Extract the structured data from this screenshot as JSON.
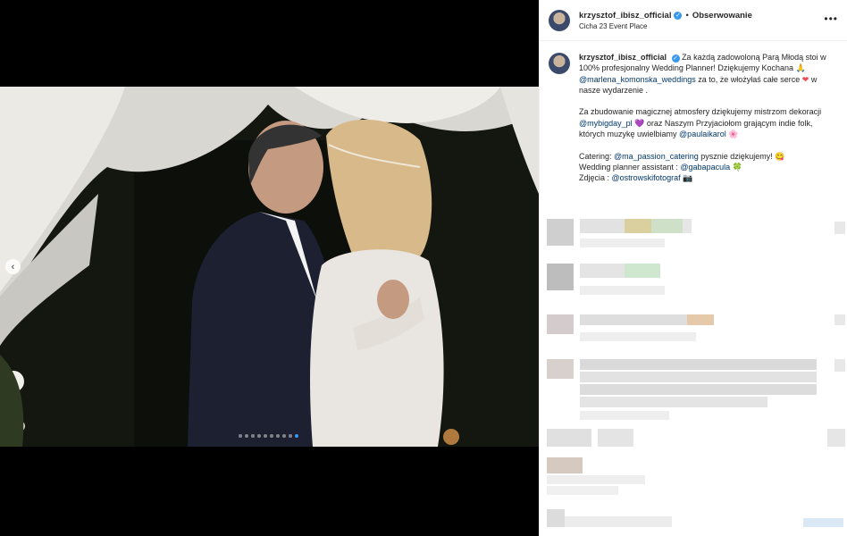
{
  "post": {
    "username": "krzysztof_ibisz_official",
    "follow_label": "Obserwowanie",
    "separator": "•",
    "location": "Cicha 23 Event Place",
    "more_label": "•••",
    "prev_arrow": "‹",
    "carousel": {
      "count": 10,
      "active_index": 9
    },
    "caption": {
      "p1_text1": "Za każdą zadowoloną Parą Młodą stoi w 100% profesjonalny Wedding Planner! Dziękujemy Kochana 🙏",
      "p1_mention1": "@marlena_komonska_weddings",
      "p1_text2": " za to, że włożyłaś całe serce ",
      "p1_heart": "❤",
      "p1_text3": " w nasze wydarzenie .",
      "p2_text1": "Za zbudowanie magicznej atmosfery dziękujemy mistrzom dekoracji ",
      "p2_mention1": "@mybigday_pl",
      "p2_emoji1": " 💜",
      "p2_text2": " oraz Naszym Przyjaciołom grającym indie folk, których muzykę uwielbiamy ",
      "p2_mention2": "@paulaikarol",
      "p2_emoji2": " 🌸",
      "p3_text1": "Catering: ",
      "p3_mention1": "@ma_passion_catering",
      "p3_text2": " pysznie dziękujemy! 😋",
      "p3_text3": "Wedding planner assistant : ",
      "p3_mention2": "@gabapacula",
      "p3_emoji1": " 🍀",
      "p3_text4": "Zdjęcia : ",
      "p3_mention3": "@ostrowskifotograf",
      "p3_emoji2": " 📷"
    }
  },
  "colors": {
    "verified": "#3897f0",
    "mention": "#00376b",
    "heart": "#ed4956",
    "active_dot": "#3897f0"
  },
  "icons": [
    "verified-icon",
    "more-options-icon",
    "prev-arrow-icon",
    "avatar-icon"
  ]
}
